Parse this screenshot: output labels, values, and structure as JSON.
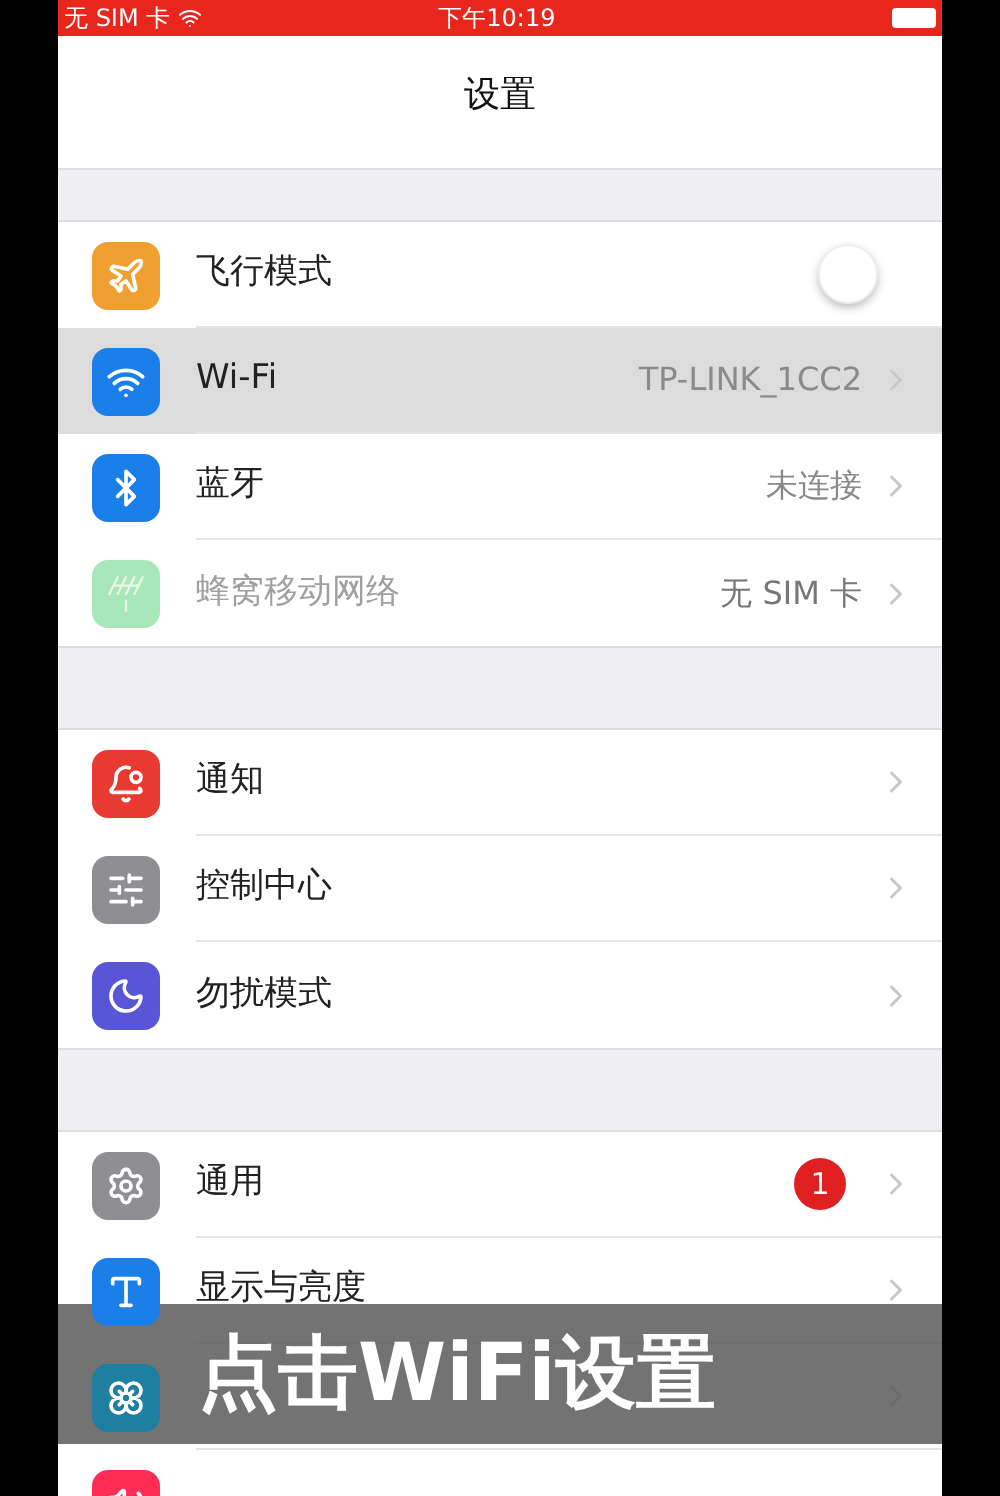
{
  "status_bar": {
    "carrier": "无 SIM 卡",
    "time": "下午10:19"
  },
  "nav": {
    "title": "设置"
  },
  "sections": [
    {
      "rows": [
        {
          "kind": "toggle",
          "label": "飞行模式",
          "color": "#f0a030",
          "on": false,
          "selected": false,
          "disabled": false
        },
        {
          "kind": "link",
          "label": "Wi-Fi",
          "value": "TP-LINK_1CC2",
          "color": "#1a7fe8",
          "selected": true,
          "disabled": false
        },
        {
          "kind": "link",
          "label": "蓝牙",
          "value": "未连接",
          "color": "#1a7fe8",
          "selected": false,
          "disabled": false
        },
        {
          "kind": "link",
          "label": "蜂窝移动网络",
          "value": "无 SIM 卡",
          "color": "#a8e8b8",
          "selected": false,
          "disabled": true
        }
      ]
    },
    {
      "rows": [
        {
          "kind": "link",
          "label": "通知",
          "color": "#e83a30",
          "selected": false,
          "disabled": false
        },
        {
          "kind": "link",
          "label": "控制中心",
          "color": "#8e8e93",
          "selected": false,
          "disabled": false
        },
        {
          "kind": "link",
          "label": "勿扰模式",
          "color": "#5856d6",
          "selected": false,
          "disabled": false
        }
      ]
    },
    {
      "rows": [
        {
          "kind": "link",
          "label": "通用",
          "badge": "1",
          "color": "#8e8e93",
          "selected": false,
          "disabled": false
        },
        {
          "kind": "link",
          "label": "显示与亮度",
          "color": "#1a7fe8",
          "selected": false,
          "disabled": false
        },
        {
          "kind": "link",
          "color": "#1f7fa0",
          "selected": false,
          "disabled": false
        },
        {
          "kind": "cut",
          "color": "#ff2d55",
          "selected": false,
          "disabled": false
        }
      ]
    }
  ],
  "caption": "点击WiFi设置"
}
